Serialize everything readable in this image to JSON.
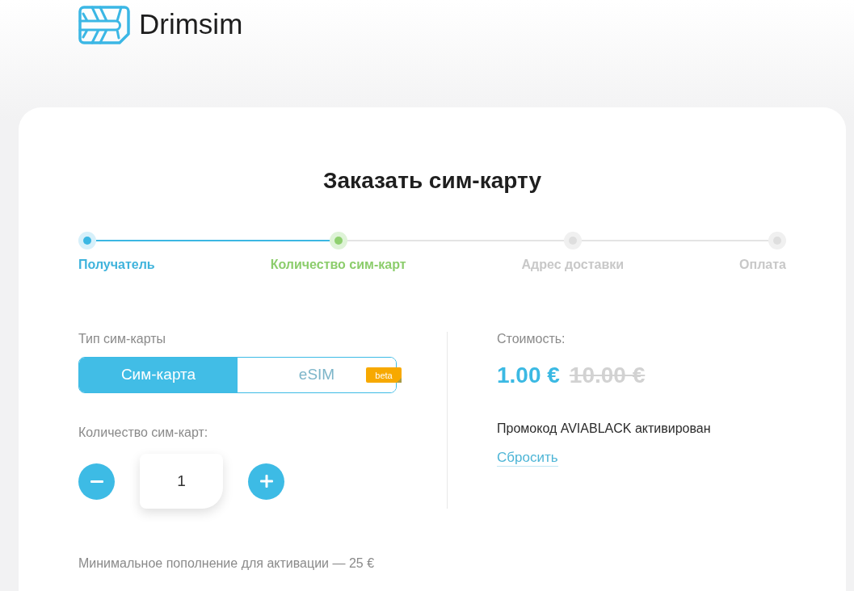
{
  "header": {
    "brand": "Drimsim"
  },
  "title": "Заказать сим-карту",
  "steps": [
    {
      "label": "Получатель",
      "completed": true,
      "selected": false
    },
    {
      "label": "Количество сим-карт",
      "completed": false,
      "selected": true
    },
    {
      "label": "Адрес доставки",
      "completed": false,
      "selected": false
    },
    {
      "label": "Оплата",
      "completed": false,
      "selected": false
    }
  ],
  "sim_type": {
    "label": "Тип сим-карты",
    "options": [
      {
        "label": "Сим-карта",
        "selected": true
      },
      {
        "label": "eSIM",
        "selected": false,
        "badge": "beta"
      }
    ]
  },
  "quantity": {
    "label": "Количество сим-карт:",
    "value": "1"
  },
  "cost": {
    "label": "Стоимость:",
    "price": "1.00 €",
    "old_price": "10.00 €",
    "promo_text": "Промокод AVIABLACK активирован",
    "reset_link": "Сбросить"
  },
  "note": "Минимальное пополнение для активации — 25 €"
}
